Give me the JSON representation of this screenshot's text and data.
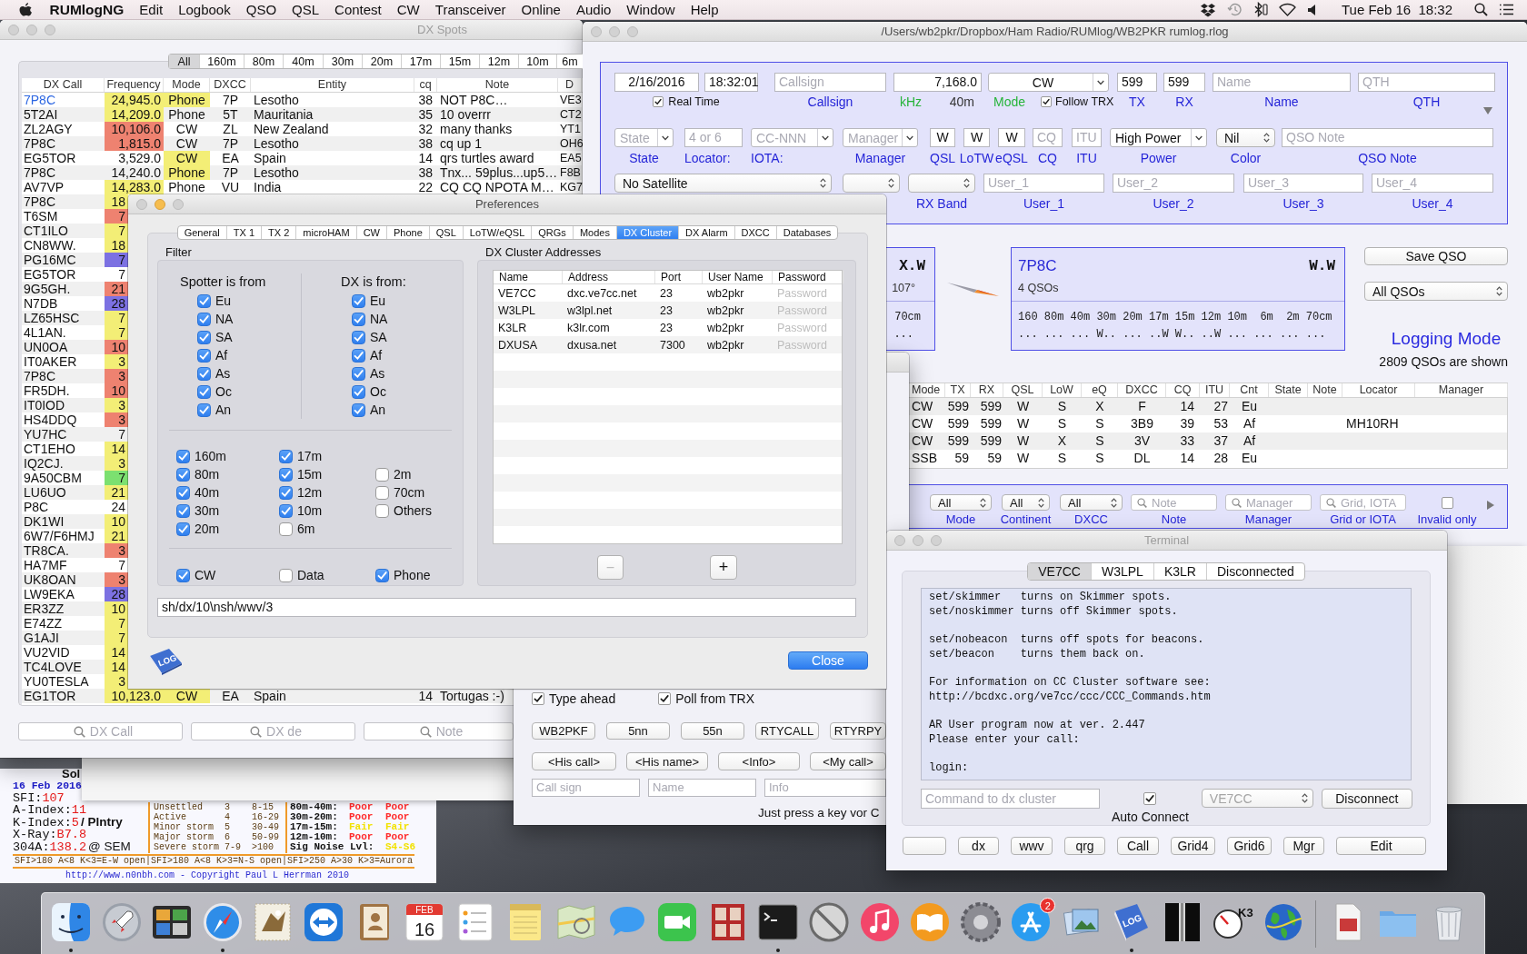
{
  "menu_bar": {
    "app_name": "RUMlogNG",
    "menus": [
      "Edit",
      "Logbook",
      "QSO",
      "QSL",
      "Contest",
      "CW",
      "Transceiver",
      "Online",
      "Audio",
      "Window",
      "Help"
    ],
    "clock": "Tue Feb 16  18:32"
  },
  "dx_spots": {
    "title": "DX Spots",
    "bands": [
      {
        "label": "All",
        "selected": true
      },
      {
        "label": "160m",
        "selected": false
      },
      {
        "label": "80m",
        "selected": false
      },
      {
        "label": "40m",
        "selected": false
      },
      {
        "label": "30m",
        "selected": false
      },
      {
        "label": "20m",
        "selected": false
      },
      {
        "label": "17m",
        "selected": false
      },
      {
        "label": "15m",
        "selected": false
      },
      {
        "label": "12m",
        "selected": false
      },
      {
        "label": "10m",
        "selected": false
      },
      {
        "label": "6m",
        "selected": false
      }
    ],
    "columns": [
      "DX Call",
      "Frequency",
      "Mode",
      "DXCC",
      "Entity",
      "cq",
      "Note",
      "D"
    ],
    "rows": [
      {
        "call": {
          "text": "7P8C",
          "color": "#2c66e2"
        },
        "frequency": {
          "text": "24,945.0",
          "color": "#f3ee76"
        },
        "mode": {
          "text": "Phone",
          "color": "#f3ee76"
        },
        "dxcc": "7P",
        "entity": "Lesotho",
        "cq": "38",
        "note": "NOT P8C…",
        "column_8": "VE3"
      },
      {
        "call": {
          "text": "5T2AI"
        },
        "frequency": {
          "text": "14,209.0",
          "color": "#f3ee76"
        },
        "mode": {
          "text": "Phone"
        },
        "dxcc": "5T",
        "entity": "Mauritania",
        "cq": "35",
        "note": "10 overrr",
        "column_8": "CT2"
      },
      {
        "call": {
          "text": "ZL2AGY"
        },
        "frequency": {
          "text": "10,106.0",
          "color": "#ee8270"
        },
        "mode": {
          "text": "CW"
        },
        "dxcc": "ZL",
        "entity": "New Zealand",
        "cq": "32",
        "note": "many thanks",
        "column_8": "YT1"
      },
      {
        "call": {
          "text": "7P8C"
        },
        "frequency": {
          "text": "1,815.0",
          "color": "#ee8270"
        },
        "mode": {
          "text": "CW"
        },
        "dxcc": "7P",
        "entity": "Lesotho",
        "cq": "38",
        "note": "cq up 1",
        "column_8": "OH6"
      },
      {
        "call": {
          "text": "EG5TOR"
        },
        "frequency": {
          "text": "3,529.0"
        },
        "mode": {
          "text": "CW",
          "color": "#f3ee76"
        },
        "dxcc": "EA",
        "entity": "Spain",
        "cq": "14",
        "note": "qrs turtles award",
        "column_8": "EA5"
      },
      {
        "call": {
          "text": "7P8C"
        },
        "frequency": {
          "text": "14,240.0"
        },
        "mode": {
          "text": "Phone",
          "color": "#f3ee76"
        },
        "dxcc": "7P",
        "entity": "Lesotho",
        "cq": "38",
        "note": "Tnx... 59plus...up5…",
        "column_8": "F8B"
      },
      {
        "call": {
          "text": "AV7VP"
        },
        "frequency": {
          "text": "14,283.0",
          "color": "#f3ee76"
        },
        "mode": {
          "text": "Phone"
        },
        "dxcc": "VU",
        "entity": "India",
        "cq": "22",
        "note": "CQ CQ NPOTA M…",
        "column_8": "KG7"
      },
      {
        "call": {
          "text": "7P8C"
        },
        "frequency": {
          "text": "18",
          "color": "#f3ee76"
        }
      },
      {
        "call": {
          "text": "T6SM"
        },
        "frequency": {
          "text": "7",
          "color": "#ee8270"
        }
      },
      {
        "call": {
          "text": "CT1ILO"
        },
        "frequency": {
          "text": "7",
          "color": "#f3ee76"
        }
      },
      {
        "call": {
          "text": "CN8WW."
        },
        "frequency": {
          "text": "18",
          "color": "#f3ee76"
        }
      },
      {
        "call": {
          "text": "PG16MC"
        },
        "frequency": {
          "text": "7",
          "color": "#7c71e2"
        }
      },
      {
        "call": {
          "text": "EG5TOR"
        },
        "frequency": {
          "text": "7"
        }
      },
      {
        "call": {
          "text": "9G5GH."
        },
        "frequency": {
          "text": "21",
          "color": "#ee8270"
        }
      },
      {
        "call": {
          "text": "N7DB"
        },
        "frequency": {
          "text": "28",
          "color": "#7c71e2"
        }
      },
      {
        "call": {
          "text": "LZ65HSC"
        },
        "frequency": {
          "text": "7",
          "color": "#f3ee76"
        }
      },
      {
        "call": {
          "text": "4L1AN."
        },
        "frequency": {
          "text": "7",
          "color": "#f3ee76"
        }
      },
      {
        "call": {
          "text": "UN0OA"
        },
        "frequency": {
          "text": "10",
          "color": "#ee8270"
        }
      },
      {
        "call": {
          "text": "IT0AKER"
        },
        "frequency": {
          "text": "3",
          "color": "#f3ee76"
        }
      },
      {
        "call": {
          "text": "7P8C"
        },
        "frequency": {
          "text": "3",
          "color": "#ee8270"
        }
      },
      {
        "call": {
          "text": "FR5DH."
        },
        "frequency": {
          "text": "10",
          "color": "#ee8270"
        }
      },
      {
        "call": {
          "text": "IT0IOD"
        },
        "frequency": {
          "text": "3",
          "color": "#f3ee76"
        }
      },
      {
        "call": {
          "text": "HS4DDQ"
        },
        "frequency": {
          "text": "3",
          "color": "#ee8270"
        }
      },
      {
        "call": {
          "text": "YU7HC"
        },
        "frequency": {
          "text": "7"
        }
      },
      {
        "call": {
          "text": "CT1EHO"
        },
        "frequency": {
          "text": "14",
          "color": "#f3ee76"
        }
      },
      {
        "call": {
          "text": "IQ2CJ."
        },
        "frequency": {
          "text": "3",
          "color": "#f3ee76"
        }
      },
      {
        "call": {
          "text": "9A50CBM"
        },
        "frequency": {
          "text": "7",
          "color": "#7ce070"
        }
      },
      {
        "call": {
          "text": "LU6UO"
        },
        "frequency": {
          "text": "21",
          "color": "#f3ee76"
        }
      },
      {
        "call": {
          "text": "P8C"
        },
        "frequency": {
          "text": "24"
        }
      },
      {
        "call": {
          "text": "DK1WI"
        },
        "frequency": {
          "text": "10",
          "color": "#f3ee76"
        }
      },
      {
        "call": {
          "text": "6W7/F6HMJ"
        },
        "frequency": {
          "text": "21",
          "color": "#f3ee76"
        }
      },
      {
        "call": {
          "text": "TR8CA."
        },
        "frequency": {
          "text": "3",
          "color": "#ee8270"
        }
      },
      {
        "call": {
          "text": "HA7MF"
        },
        "frequency": {
          "text": "7"
        }
      },
      {
        "call": {
          "text": "UK8OAN"
        },
        "frequency": {
          "text": "3",
          "color": "#ee8270"
        }
      },
      {
        "call": {
          "text": "LW9EKA"
        },
        "frequency": {
          "text": "28",
          "color": "#7c71e2"
        }
      },
      {
        "call": {
          "text": "ER3ZZ"
        },
        "frequency": {
          "text": "10",
          "color": "#f3ee76"
        }
      },
      {
        "call": {
          "text": "E74ZZ"
        },
        "frequency": {
          "text": "7",
          "color": "#f3ee76"
        }
      },
      {
        "call": {
          "text": "G1AJI"
        },
        "frequency": {
          "text": "7",
          "color": "#f3ee76"
        }
      },
      {
        "call": {
          "text": "VU2VID"
        },
        "frequency": {
          "text": "14",
          "color": "#f3ee76"
        }
      },
      {
        "call": {
          "text": "TC4LOVE"
        },
        "frequency": {
          "text": "14",
          "color": "#f3ee76"
        }
      },
      {
        "call": {
          "text": "YU0TESLA"
        },
        "frequency": {
          "text": "3",
          "color": "#f3ee76"
        }
      },
      {
        "call": {
          "text": "EG1TOR"
        },
        "frequency": {
          "text": "10,123.0",
          "color": "#f3ee76"
        },
        "mode": {
          "text": "CW",
          "color": "#f3ee76"
        },
        "dxcc": "EA",
        "entity": "Spain",
        "cq": "14",
        "note": "Tortugas :-)"
      }
    ],
    "search_fields": [
      {
        "placeholder": "DX Call"
      },
      {
        "placeholder": "DX de"
      },
      {
        "placeholder": "Note"
      }
    ]
  },
  "main_window": {
    "title": "/Users/wb2pkr/Dropbox/Ham Radio/RUMlog/WB2PKR rumlog.rlog",
    "entry": {
      "date": "2/16/2016",
      "time": "18:32:01",
      "real_time": {
        "label": "Real Time",
        "checked": true
      },
      "callsign": {
        "kind": "field",
        "placeholder": "Callsign",
        "label": "Callsign"
      },
      "frequency": {
        "kind": "field",
        "value": "7,168.0",
        "unit": "kHz",
        "band": "40m"
      },
      "mode": {
        "kind": "combo",
        "value": "CW",
        "label": "Mode"
      },
      "follow_trx": {
        "label": "Follow TRX",
        "checked": true
      },
      "tx": {
        "kind": "field",
        "value": "599",
        "label": "TX"
      },
      "rx": {
        "kind": "field",
        "value": "599",
        "label": "RX"
      },
      "name": {
        "kind": "field",
        "placeholder": "Name",
        "label": "Name"
      },
      "qth": {
        "kind": "field",
        "placeholder": "QTH",
        "label": "QTH"
      },
      "row_2": [
        {
          "kind": "combo",
          "placeholder": "State",
          "label": "State"
        },
        {
          "kind": "field",
          "placeholder": "4 or 6",
          "label": "Locator:"
        },
        {
          "kind": "combo",
          "placeholder": "CC-NNN",
          "label": "IOTA:"
        },
        {
          "kind": "combo",
          "placeholder": "Manager",
          "label": "Manager"
        },
        {
          "kind": "field",
          "value": "W",
          "label": "QSL"
        },
        {
          "kind": "field",
          "value": "W",
          "label": "LoTW"
        },
        {
          "kind": "field",
          "value": "W",
          "label": "eQSL"
        },
        {
          "kind": "field",
          "placeholder": "CQ",
          "label": "CQ"
        },
        {
          "kind": "field",
          "placeholder": "ITU",
          "label": "ITU"
        },
        {
          "kind": "combo",
          "value": "High Power",
          "label": "Power"
        },
        {
          "kind": "popup",
          "value": "Nil",
          "label": "Color"
        },
        {
          "kind": "field",
          "placeholder": "QSO Note",
          "label": "QSO Note"
        }
      ],
      "row_3": [
        {
          "kind": "popup",
          "value": "No Satellite"
        },
        {
          "kind": "popup"
        },
        {
          "kind": "popup",
          "label": "RX Band"
        },
        {
          "kind": "field",
          "placeholder": "User_1",
          "label": "User_1"
        },
        {
          "kind": "field",
          "placeholder": "User_2",
          "label": "User_2"
        },
        {
          "kind": "field",
          "placeholder": "User_3",
          "label": "User_3"
        },
        {
          "kind": "field",
          "placeholder": "User_4",
          "label": "User_4"
        }
      ]
    },
    "info": {
      "side_box": {
        "status": "X.W",
        "bearing": "107°",
        "band": "70cm",
        "band_status": "..."
      },
      "main_box": {
        "call": "7P8C",
        "status": "W.W",
        "qso_count": "4 QSOs",
        "bands": [
          {
            "band": "160",
            "status": "..."
          },
          {
            "band": "80m",
            "status": "..."
          },
          {
            "band": "40m",
            "status": "..."
          },
          {
            "band": "30m",
            "status": "W.."
          },
          {
            "band": "20m",
            "status": "..."
          },
          {
            "band": "17m",
            "status": "..W"
          },
          {
            "band": "15m",
            "status": "W.."
          },
          {
            "band": "12m",
            "status": "..W"
          },
          {
            "band": "10m",
            "status": "..."
          },
          {
            "band": "6m",
            "status": "..."
          },
          {
            "band": "2m",
            "status": "..."
          },
          {
            "band": "70cm",
            "status": "..."
          }
        ]
      },
      "save_button": "Save QSO",
      "view_popup": {
        "kind": "popup",
        "value": "All QSOs"
      },
      "mode_title": "Logging Mode",
      "summary": "2809 QSOs are shown"
    },
    "log_table": {
      "columns": [
        "Mode",
        "TX",
        "RX",
        "QSL",
        "LoW",
        "eQ",
        "DXCC",
        "CQ",
        "ITU",
        "Cnt",
        "State",
        "Note",
        "Locator",
        "Manager"
      ],
      "rows": [
        {
          "mode": "CW",
          "tx": "599",
          "rx": "599",
          "qsl": "W",
          "low": "S",
          "eq": "X",
          "dxcc": "F",
          "cq": "14",
          "itu": "27",
          "cnt": "Eu"
        },
        {
          "mode": "CW",
          "tx": "599",
          "rx": "599",
          "qsl": "W",
          "low": "S",
          "eq": "S",
          "dxcc": "3B9",
          "cq": "39",
          "itu": "53",
          "cnt": "Af",
          "locator": "MH10RH"
        },
        {
          "mode": "CW",
          "tx": "599",
          "rx": "599",
          "qsl": "W",
          "low": "X",
          "eq": "S",
          "dxcc": "3V",
          "cq": "33",
          "itu": "37",
          "cnt": "Af"
        },
        {
          "mode": "SSB",
          "tx": "59",
          "rx": "59",
          "qsl": "W",
          "low": "S",
          "eq": "S",
          "dxcc": "DL",
          "cq": "14",
          "itu": "28",
          "cnt": "Eu"
        }
      ]
    },
    "filters": [
      {
        "kind": "popup",
        "value": "All",
        "label": "Mode"
      },
      {
        "kind": "popup",
        "value": "All",
        "label": "Continent"
      },
      {
        "kind": "popup",
        "value": "All",
        "label": "DXCC"
      },
      {
        "kind": "search",
        "placeholder": "Note",
        "label": "Note"
      },
      {
        "kind": "search",
        "placeholder": "Manager",
        "label": "Manager"
      },
      {
        "kind": "search",
        "placeholder": "Grid, IOTA",
        "label": "Grid or IOTA"
      },
      {
        "kind": "checkbox",
        "checked": false,
        "label": "Invalid only"
      }
    ]
  },
  "preferences": {
    "title": "Preferences",
    "tabs": [
      {
        "label": "General",
        "selected": false
      },
      {
        "label": "TX 1",
        "selected": false
      },
      {
        "label": "TX 2",
        "selected": false
      },
      {
        "label": "microHAM",
        "selected": false
      },
      {
        "label": "CW",
        "selected": false
      },
      {
        "label": "Phone",
        "selected": false
      },
      {
        "label": "QSL",
        "selected": false
      },
      {
        "label": "LoTW/eQSL",
        "selected": false
      },
      {
        "label": "QRGs",
        "selected": false
      },
      {
        "label": "Modes",
        "selected": false
      },
      {
        "label": "DX Cluster",
        "selected": true
      },
      {
        "label": "DX Alarm",
        "selected": false
      },
      {
        "label": "DXCC",
        "selected": false
      },
      {
        "label": "Databases",
        "selected": false
      }
    ],
    "filter": {
      "title": "Filter",
      "spotter": {
        "title": "Spotter is from",
        "items": [
          {
            "label": "Eu",
            "checked": true
          },
          {
            "label": "NA",
            "checked": true
          },
          {
            "label": "SA",
            "checked": true
          },
          {
            "label": "Af",
            "checked": true
          },
          {
            "label": "As",
            "checked": true
          },
          {
            "label": "Oc",
            "checked": true
          },
          {
            "label": "An",
            "checked": true
          }
        ]
      },
      "dx": {
        "title": "DX is from:",
        "items": [
          {
            "label": "Eu",
            "checked": true
          },
          {
            "label": "NA",
            "checked": true
          },
          {
            "label": "SA",
            "checked": true
          },
          {
            "label": "Af",
            "checked": true
          },
          {
            "label": "As",
            "checked": true
          },
          {
            "label": "Oc",
            "checked": true
          },
          {
            "label": "An",
            "checked": true
          }
        ]
      },
      "band_columns": [
        [
          {
            "label": "160m",
            "checked": true
          },
          {
            "label": "80m",
            "checked": true
          },
          {
            "label": "40m",
            "checked": true
          },
          {
            "label": "30m",
            "checked": true
          },
          {
            "label": "20m",
            "checked": true
          }
        ],
        [
          {
            "label": "17m",
            "checked": true
          },
          {
            "label": "15m",
            "checked": true
          },
          {
            "label": "12m",
            "checked": true
          },
          {
            "label": "10m",
            "checked": true
          },
          {
            "label": "6m",
            "checked": false
          }
        ],
        [
          {
            "label": "2m",
            "checked": false
          },
          {
            "label": "70cm",
            "checked": false
          },
          {
            "label": "Others",
            "checked": false
          }
        ]
      ],
      "modes": [
        {
          "label": "CW",
          "checked": true
        },
        {
          "label": "Data",
          "checked": false
        },
        {
          "label": "Phone",
          "checked": true
        }
      ]
    },
    "addresses": {
      "title": "DX Cluster Addresses",
      "columns": [
        "Name",
        "Address",
        "Port",
        "User Name",
        "Password"
      ],
      "rows": [
        {
          "name": "VE7CC",
          "address": "dxc.ve7cc.net",
          "port": "23",
          "user": "wb2pkr",
          "password_placeholder": "Password"
        },
        {
          "name": "W3LPL",
          "address": "w3lpl.net",
          "port": "23",
          "user": "wb2pkr",
          "password_placeholder": "Password"
        },
        {
          "name": "K3LR",
          "address": "k3lr.com",
          "port": "23",
          "user": "wb2pkr",
          "password_placeholder": "Password"
        },
        {
          "name": "DXUSA",
          "address": "dxusa.net",
          "port": "7300",
          "user": "wb2pkr",
          "password_placeholder": "Password"
        }
      ],
      "remove_button": {
        "label": "−",
        "disabled": true
      },
      "add_button": {
        "label": "+",
        "disabled": false
      }
    },
    "command": "sh/dx/10\\nsh/wwv/3",
    "app_icon_label": "LOG",
    "close_button": "Close"
  },
  "keyer": {
    "type_ahead": {
      "label": "Type ahead",
      "checked": true
    },
    "poll_trx": {
      "label": "Poll from TRX",
      "checked": true
    },
    "macro_buttons": [
      "WB2PKF",
      "5nn",
      "55n",
      "RTYCALL",
      "RTYRPY"
    ],
    "insert_buttons": [
      "<His call>",
      "<His name>",
      "<Info>",
      "<My call>"
    ],
    "fields": [
      {
        "placeholder": "Call sign"
      },
      {
        "placeholder": "Name"
      },
      {
        "placeholder": "Info"
      }
    ],
    "hint": "Just press a key vor C"
  },
  "terminal": {
    "title": "Terminal",
    "tabs": [
      {
        "label": "VE7CC",
        "selected": true
      },
      {
        "label": "W3LPL",
        "selected": false
      },
      {
        "label": "K3LR",
        "selected": false
      },
      {
        "label": "Disconnected",
        "selected": false
      }
    ],
    "output": [
      [
        "set/skimmer   turns on Skimmer spots.",
        "set/noskimmer turns off Skimmer spots."
      ],
      [
        "set/nobeacon  turns off spots for beacons.",
        "set/beacon    turns them back on."
      ],
      [
        "For information on CC Cluster software see:",
        "http://bcdxc.org/ve7cc/ccc/CCC_Commands.htm"
      ],
      [
        "AR User program now at ver. 2.447",
        "Please enter your call:"
      ],
      [
        "login:"
      ]
    ],
    "command_placeholder": "Command to dx cluster",
    "auto_connect": {
      "label": "Auto Connect",
      "checked": true
    },
    "cluster_popup": {
      "value": "VE7CC",
      "disabled": true
    },
    "disconnect_button": "Disconnect",
    "buttons": [
      {
        "kind": "blank"
      },
      {
        "kind": "label",
        "label": "dx"
      },
      {
        "kind": "label",
        "label": "wwv"
      },
      {
        "kind": "label",
        "label": "qrg"
      },
      {
        "kind": "label",
        "label": "Call"
      },
      {
        "kind": "label",
        "label": "Grid4"
      },
      {
        "kind": "label",
        "label": "Grid6"
      },
      {
        "kind": "label",
        "label": "Mgr"
      },
      {
        "kind": "label",
        "label": "Edit"
      }
    ]
  },
  "solar": {
    "title": "Sol",
    "date": "16 Feb 2016",
    "readings": [
      {
        "label": "SFI:",
        "value": "107"
      },
      {
        "label": "A-Index:",
        "value": "11"
      },
      {
        "label": "K-Index:",
        "value": "5",
        "note": "/ Plntry"
      },
      {
        "label": "X-Ray:",
        "value": "B7.8"
      },
      {
        "label": "304A:",
        "value": "138.2",
        "note": "@ SEM"
      }
    ],
    "geomag": [
      [
        "Unsettled",
        "3",
        "8-15"
      ],
      [
        "Active",
        "4",
        "16-29"
      ],
      [
        "Minor storm",
        "5",
        "30-49"
      ],
      [
        "Major storm",
        "6",
        "50-99"
      ],
      [
        "Severe storm",
        "7-9",
        ">100"
      ]
    ],
    "bands": [
      {
        "band": "80m-40m:",
        "conditions": [
          {
            "text": "Poor",
            "color": "#ff2a2a"
          },
          {
            "text": "Poor",
            "color": "#ff2a2a"
          }
        ]
      },
      {
        "band": "30m-20m:",
        "conditions": [
          {
            "text": "Poor",
            "color": "#ff2a2a"
          },
          {
            "text": "Poor",
            "color": "#ff2a2a"
          }
        ]
      },
      {
        "band": "17m-15m:",
        "conditions": [
          {
            "text": "Fair",
            "color": "#f2e200"
          },
          {
            "text": "Fair",
            "color": "#f2e200"
          }
        ]
      },
      {
        "band": "12m-10m:",
        "conditions": [
          {
            "text": "Poor",
            "color": "#ff2a2a"
          },
          {
            "text": "Poor",
            "color": "#ff2a2a"
          }
        ]
      }
    ],
    "noise": {
      "label": "Sig Noise Lvl:",
      "value": "S4-S6"
    },
    "legend": "SFI>180 A<8 K<3=E-W open|SFI>180 A<8 K>3=N-S open|SFI>250 A>30 K>3=Aurora",
    "credit": "http://www.n0nbh.com - Copyright Paul L Herrman 2010"
  },
  "dock": {
    "apps": [
      {
        "kind": "finder",
        "running": true
      },
      {
        "kind": "rocket",
        "running": false
      },
      {
        "kind": "window_grid",
        "running": false
      },
      {
        "kind": "compass",
        "running": true
      },
      {
        "kind": "stamp",
        "running": false
      },
      {
        "kind": "double_arrow",
        "running": false
      },
      {
        "kind": "address_book",
        "running": false
      },
      {
        "kind": "calendar",
        "month": "FEB",
        "day": "16",
        "running": false
      },
      {
        "kind": "checklist",
        "running": false
      },
      {
        "kind": "notepad",
        "running": false
      },
      {
        "kind": "map",
        "running": false
      },
      {
        "kind": "speech_bubble",
        "running": false
      },
      {
        "kind": "video_camera",
        "running": false
      },
      {
        "kind": "photo_strip",
        "running": false
      },
      {
        "kind": "terminal",
        "running": true
      },
      {
        "kind": "no_sign",
        "running": false
      },
      {
        "kind": "music_note",
        "running": false
      },
      {
        "kind": "open_book",
        "running": false
      },
      {
        "kind": "gear",
        "running": false
      },
      {
        "kind": "app_store",
        "badge": "2",
        "running": false
      },
      {
        "kind": "image_stack",
        "running": false
      },
      {
        "kind": "book",
        "label": "LOG",
        "running": true
      },
      {
        "kind": "screen",
        "running": false
      },
      {
        "kind": "gauge",
        "label": "K3",
        "running": false
      },
      {
        "kind": "globe",
        "running": false
      }
    ],
    "stacks": [
      {
        "kind": "document"
      },
      {
        "kind": "folder"
      },
      {
        "kind": "trash"
      }
    ]
  }
}
